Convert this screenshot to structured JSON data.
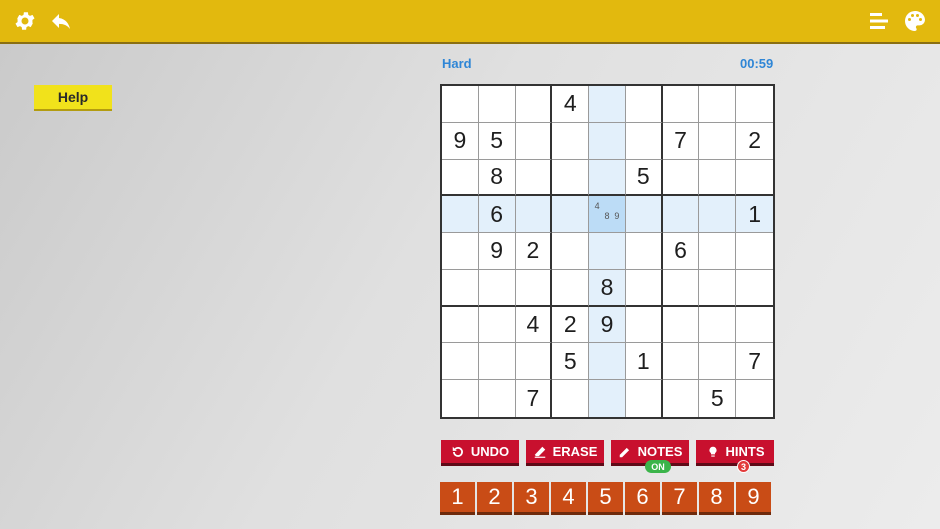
{
  "colors": {
    "topbar": "#e2b90e",
    "help": "#f1e21b",
    "action_red": "#c8102e",
    "numpad_orange": "#c94c16",
    "highlight": "#e3f0fb",
    "selected": "#bcdcf6",
    "info_blue": "#2f86d6"
  },
  "topbar": {
    "icons": [
      "gear-icon",
      "back-arrow-icon",
      "menu-icon",
      "palette-icon"
    ]
  },
  "help": {
    "label": "Help"
  },
  "status": {
    "difficulty": "Hard",
    "timer": "00:59"
  },
  "board": {
    "selected": {
      "row": 3,
      "col": 4
    },
    "grid": [
      [
        "",
        "",
        "",
        "4",
        "",
        "",
        "",
        "",
        ""
      ],
      [
        "9",
        "5",
        "",
        "",
        "",
        "",
        "7",
        "",
        "2"
      ],
      [
        "",
        "8",
        "",
        "",
        "",
        "5",
        "",
        "",
        ""
      ],
      [
        "",
        "6",
        "",
        "",
        "",
        "",
        "",
        "",
        "1"
      ],
      [
        "",
        "9",
        "2",
        "",
        "",
        "",
        "6",
        "",
        ""
      ],
      [
        "",
        "",
        "",
        "",
        "8",
        "",
        "",
        "",
        ""
      ],
      [
        "",
        "",
        "4",
        "2",
        "9",
        "",
        "",
        "",
        ""
      ],
      [
        "",
        "",
        "",
        "5",
        "",
        "1",
        "",
        "",
        "7"
      ],
      [
        "",
        "",
        "7",
        "",
        "",
        "",
        "",
        "5",
        ""
      ]
    ],
    "notes": {
      "3-4": [
        "4",
        "8",
        "9"
      ]
    }
  },
  "actions": {
    "undo": "UNDO",
    "erase": "ERASE",
    "notes": "NOTES",
    "notes_state": "ON",
    "hints": "HINTS",
    "hints_count": "3"
  },
  "numpad": [
    "1",
    "2",
    "3",
    "4",
    "5",
    "6",
    "7",
    "8",
    "9"
  ]
}
